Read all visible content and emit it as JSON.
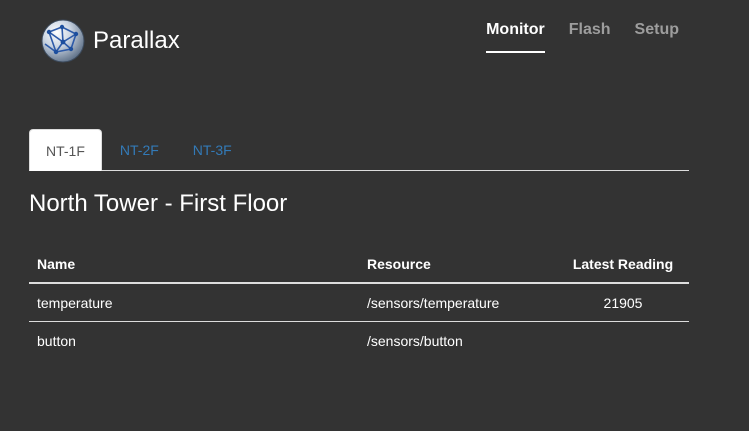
{
  "brand": {
    "name": "Parallax",
    "logo_icon": "globe-network-icon"
  },
  "topnav": {
    "items": [
      "Monitor",
      "Flash",
      "Setup"
    ],
    "active": "Monitor"
  },
  "tabs": {
    "items": [
      "NT-1F",
      "NT-2F",
      "NT-3F"
    ],
    "active": "NT-1F"
  },
  "section": {
    "title": "North Tower - First Floor"
  },
  "table": {
    "headers": [
      "Name",
      "Resource",
      "Latest Reading"
    ],
    "rows": [
      {
        "name": "temperature",
        "resource": "/sensors/temperature",
        "reading": "21905"
      },
      {
        "name": "button",
        "resource": "/sensors/button",
        "reading": ""
      }
    ]
  },
  "colors": {
    "background": "#333333",
    "link": "#337ab7",
    "text": "#ffffff",
    "nav_inactive": "#9d9d9d"
  }
}
